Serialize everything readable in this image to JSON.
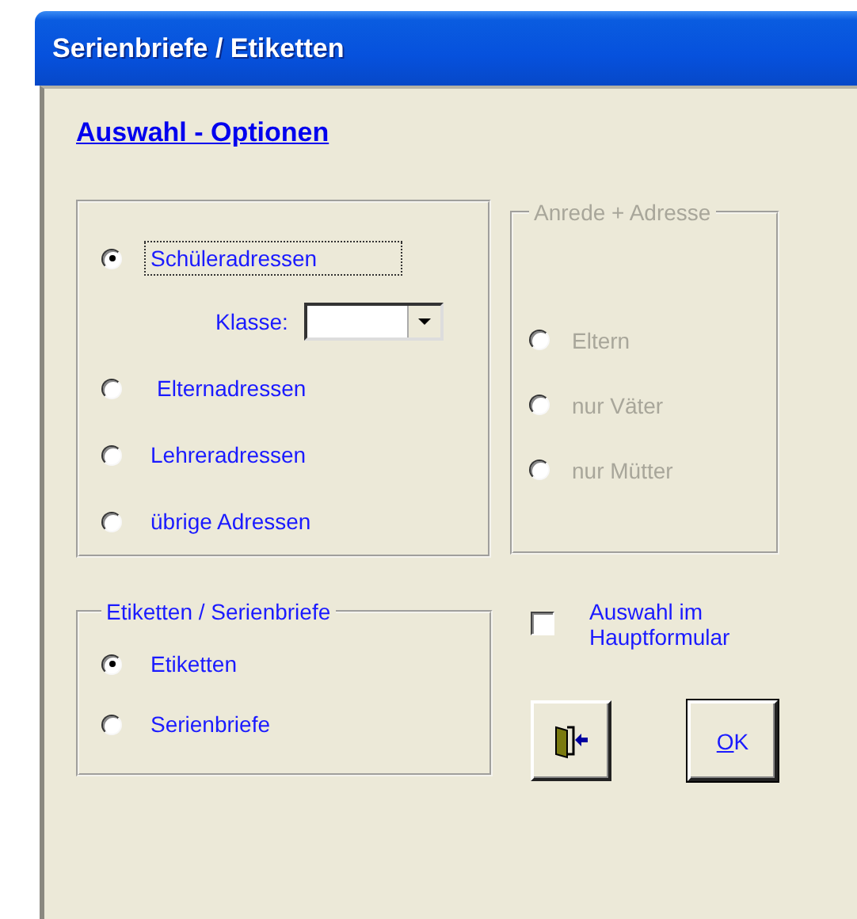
{
  "window": {
    "title": "Serienbriefe / Etiketten"
  },
  "heading": "Auswahl - Optionen",
  "address_group": {
    "options": [
      {
        "label": "Schüleradressen",
        "selected": true,
        "focused": true
      },
      {
        "label": "Elternadressen",
        "selected": false,
        "focused": false
      },
      {
        "label": "Lehreradressen",
        "selected": false,
        "focused": false
      },
      {
        "label": "übrige Adressen",
        "selected": false,
        "focused": false
      }
    ],
    "class_field": {
      "label": "Klasse:"
    }
  },
  "salutation_group": {
    "title": "Anrede + Adresse",
    "disabled": true,
    "options": [
      {
        "label": "Eltern",
        "selected": false
      },
      {
        "label": "nur Väter",
        "selected": false
      },
      {
        "label": "nur Mütter",
        "selected": false
      }
    ]
  },
  "output_group": {
    "title": "Etiketten / Serienbriefe",
    "options": [
      {
        "label": "Etiketten",
        "selected": true
      },
      {
        "label": "Serienbriefe",
        "selected": false
      }
    ]
  },
  "main_form_checkbox": {
    "label": "Auswahl im Hauptformular",
    "checked": false
  },
  "buttons": [
    {
      "kind": "exit"
    },
    {
      "kind": "text",
      "label": "OK"
    }
  ]
}
